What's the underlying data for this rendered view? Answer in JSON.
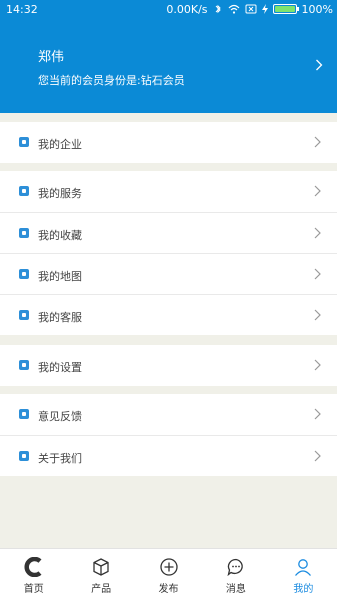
{
  "statusbar": {
    "time": "14:32",
    "network_speed": "0.00K/s",
    "battery_percent": "100%",
    "battery_level": 1.0
  },
  "profile": {
    "name": "郑伟",
    "membership": "您当前的会员身份是:钻石会员"
  },
  "menu": {
    "group1": [
      {
        "label": "我的企业",
        "icon": "enterprise-icon"
      }
    ],
    "group2": [
      {
        "label": "我的服务",
        "icon": "service-icon"
      },
      {
        "label": "我的收藏",
        "icon": "favorites-icon"
      },
      {
        "label": "我的地图",
        "icon": "map-icon"
      },
      {
        "label": "我的客服",
        "icon": "customer-service-icon"
      }
    ],
    "group3": [
      {
        "label": "我的设置",
        "icon": "settings-icon"
      }
    ],
    "group4": [
      {
        "label": "意见反馈",
        "icon": "feedback-icon"
      },
      {
        "label": "关于我们",
        "icon": "about-icon"
      }
    ]
  },
  "tabbar": {
    "items": [
      {
        "label": "首页",
        "icon": "home-c-icon"
      },
      {
        "label": "产品",
        "icon": "box-icon"
      },
      {
        "label": "发布",
        "icon": "plus-circle-icon"
      },
      {
        "label": "消息",
        "icon": "chat-bubble-icon"
      },
      {
        "label": "我的",
        "icon": "person-icon"
      }
    ],
    "active_index": 4
  },
  "colors": {
    "primary": "#0b8ad6",
    "background": "#f0f0e8",
    "active_tab": "#1a8be0"
  }
}
